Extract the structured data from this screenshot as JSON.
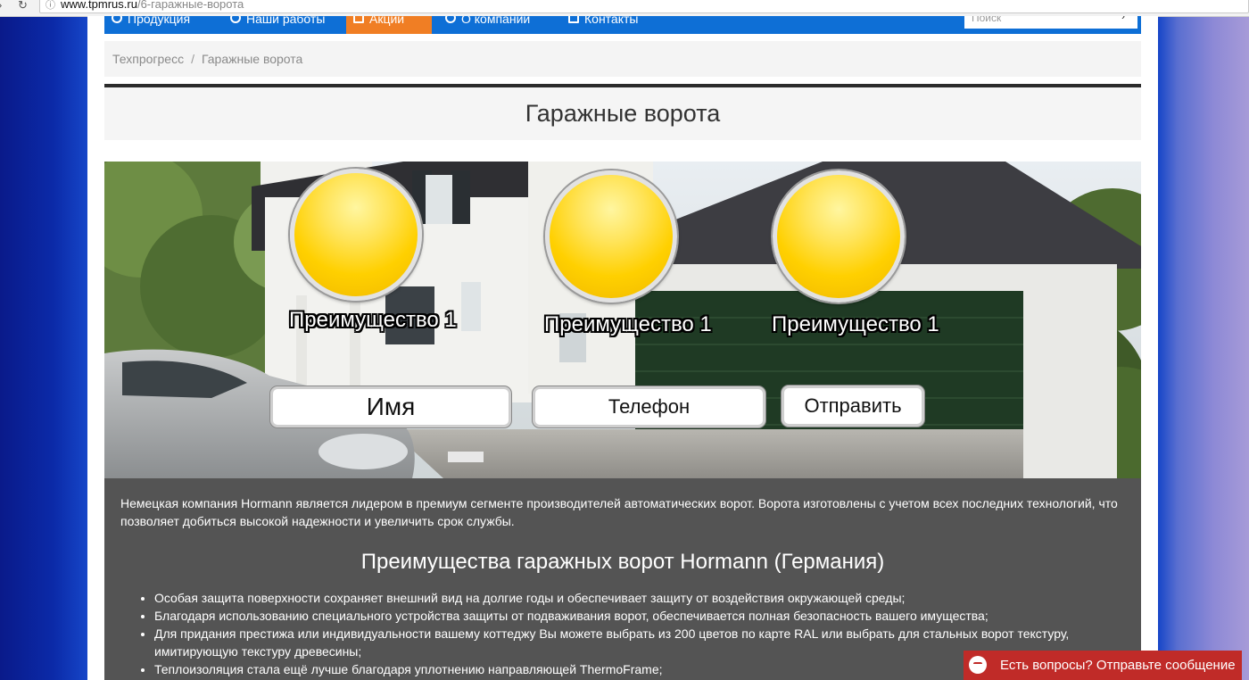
{
  "browser": {
    "url_host": "www.tpmrus.ru",
    "url_path": "/6-гаражные-ворота"
  },
  "topnav": {
    "items": [
      "Продукция",
      "Наши работы",
      "Акции",
      "О компании",
      "Контакты"
    ],
    "search_placeholder": "Поиск"
  },
  "breadcrumb": {
    "home": "Техпрогресс",
    "separator": "/",
    "current": "Гаражные ворота"
  },
  "page_title": "Гаражные ворота",
  "hero": {
    "advantages": [
      "Преимущество 1",
      "Преимущество 1",
      "Преимущество 1"
    ],
    "name_placeholder": "Имя",
    "phone_placeholder": "Телефон",
    "submit_label": "Отправить"
  },
  "content": {
    "intro": "Немецкая компания Hormann является лидером в премиум сегменте производителей автоматических ворот. Ворота изготовлены с учетом всех последних технологий, что позволяет добиться высокой надежности и увеличить срок службы.",
    "heading": "Преимущества гаражных ворот Hormann (Германия)",
    "bullets": [
      "Особая защита поверхности сохраняет внешний вид на долгие годы и обеспечивает защиту от воздействия окружающей среды;",
      "Благодаря использованию специального устройства защиты от подваживания ворот, обеспечивается полная безопасность вашего имущества;",
      "Для придания престижа или индивидуальности вашему коттеджу Вы можете выбрать из 200 цветов по карте RAL или выбрать для стальных ворот текстуру, имитирующую текстуру древесины;",
      "Теплоизоляция стала ещё лучше благодаря уплотнению направляющей ThermoFrame;"
    ]
  },
  "chat_widget": {
    "label": "Есть вопросы? Отправьте сообщение"
  },
  "colors": {
    "nav_blue": "#0e6fd6",
    "nav_orange": "#f07e24",
    "content_bg": "#545454",
    "chat_red": "#c02b28"
  }
}
